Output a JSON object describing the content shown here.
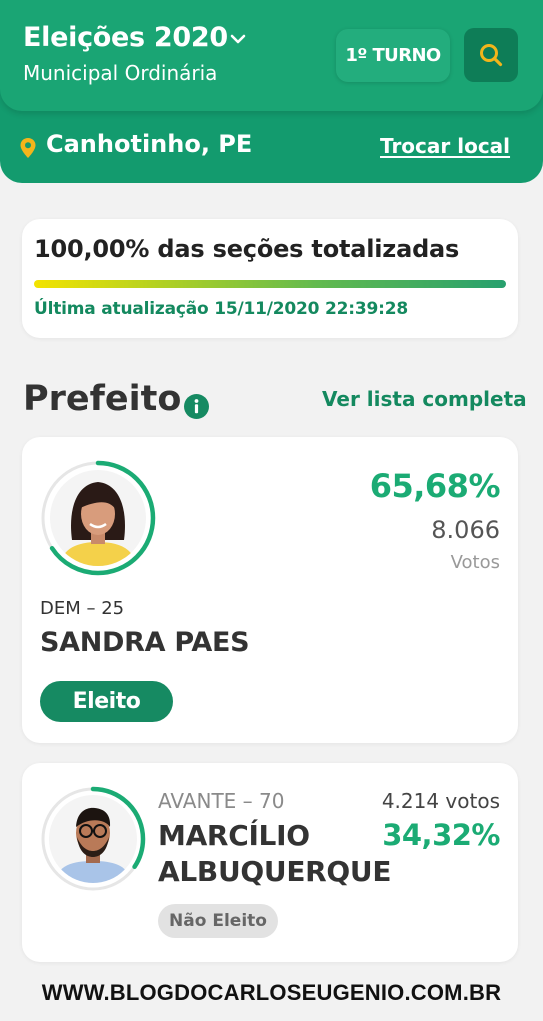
{
  "header": {
    "title": "Eleições 2020",
    "subtitle": "Municipal Ordinária",
    "turno_label": "1º TURNO",
    "location": "Canhotinho, PE",
    "change_location_label": "Trocar local",
    "icons": {
      "title_chevron": "chevron-down-icon",
      "search": "search-icon",
      "location": "map-pin-icon"
    },
    "colors": {
      "primary": "#1aa574",
      "dark": "#139b6e",
      "search_bg": "#0e7d57",
      "accent": "#f3b51b"
    }
  },
  "progress": {
    "title": "100,00% das seções totalizadas",
    "percent": 100,
    "last_update": "Última atualização 15/11/2020 22:39:28"
  },
  "section": {
    "title": "Prefeito",
    "info_icon": "info-icon",
    "view_full_list": "Ver lista completa"
  },
  "candidates": [
    {
      "percent_label": "65,68%",
      "percent": 65.68,
      "votes": "8.066",
      "votes_label": "Votos",
      "party": "DEM – 25",
      "name": "SANDRA PAES",
      "status": "Eleito"
    },
    {
      "percent_label": "34,32%",
      "percent": 34.32,
      "votes": "4.214 votos",
      "party": "AVANTE – 70",
      "name": "MARCÍLIO ALBUQUERQUE",
      "status": "Não Eleito"
    }
  ],
  "watermark": "WWW.BLOGDOCARLOSEUGENIO.COM.BR"
}
